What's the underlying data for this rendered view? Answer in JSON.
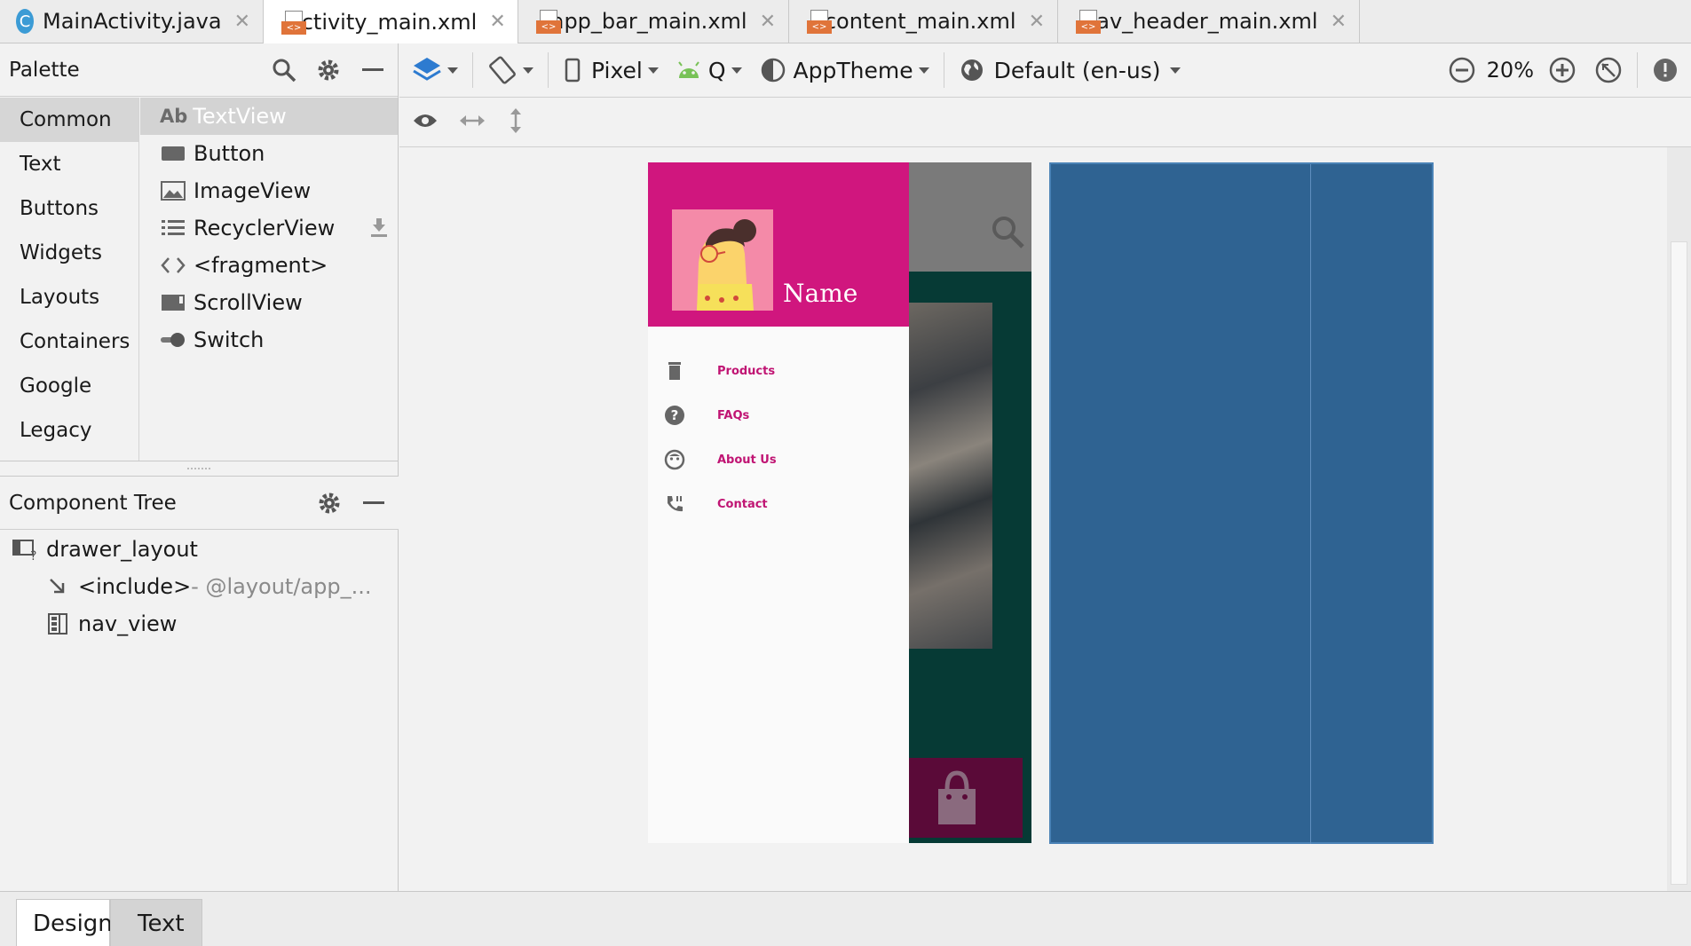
{
  "tabs": [
    {
      "label": "MainActivity.java",
      "kind": "java"
    },
    {
      "label": "activity_main.xml",
      "kind": "xml",
      "active": true
    },
    {
      "label": "app_bar_main.xml",
      "kind": "xml"
    },
    {
      "label": "content_main.xml",
      "kind": "xml"
    },
    {
      "label": "nav_header_main.xml",
      "kind": "xml"
    }
  ],
  "java_icon_letter": "C",
  "xml_icon_text": "<>",
  "close_glyph": "✕",
  "palette": {
    "title": "Palette",
    "categories": [
      "Common",
      "Text",
      "Buttons",
      "Widgets",
      "Layouts",
      "Containers",
      "Google",
      "Legacy"
    ],
    "widgets": [
      {
        "label": "TextView",
        "prefix": "Ab",
        "icon": "textview-icon"
      },
      {
        "label": "Button",
        "icon": "button-icon"
      },
      {
        "label": "ImageView",
        "icon": "image-icon"
      },
      {
        "label": "RecyclerView",
        "icon": "list-icon"
      },
      {
        "label": "<fragment>",
        "icon": "code-icon"
      },
      {
        "label": "ScrollView",
        "icon": "scrollview-icon"
      },
      {
        "label": "Switch",
        "icon": "switch-icon"
      }
    ]
  },
  "component_tree": {
    "title": "Component Tree",
    "items": [
      {
        "label": "drawer_layout"
      },
      {
        "label": "<include>",
        "suffix": " - @layout/app_..."
      },
      {
        "label": "nav_view"
      }
    ]
  },
  "toolbar": {
    "device": "Pixel",
    "api": "Q",
    "theme": "AppTheme",
    "locale": "Default (en-us)",
    "zoom": "20%"
  },
  "drawer": {
    "header_name": "Name",
    "menu": [
      {
        "label": "Products",
        "icon": "trash-icon"
      },
      {
        "label": "FAQs",
        "icon": "help-icon"
      },
      {
        "label": "About Us",
        "icon": "face-icon"
      },
      {
        "label": "Contact",
        "icon": "phone-icon"
      }
    ]
  },
  "bottom_tabs": {
    "design": "Design",
    "text": "Text"
  },
  "colors": {
    "drawer_header": "#d0167e",
    "menu_text": "#c01473",
    "blueprint": "#2f6392",
    "content_bg": "#063a35"
  }
}
